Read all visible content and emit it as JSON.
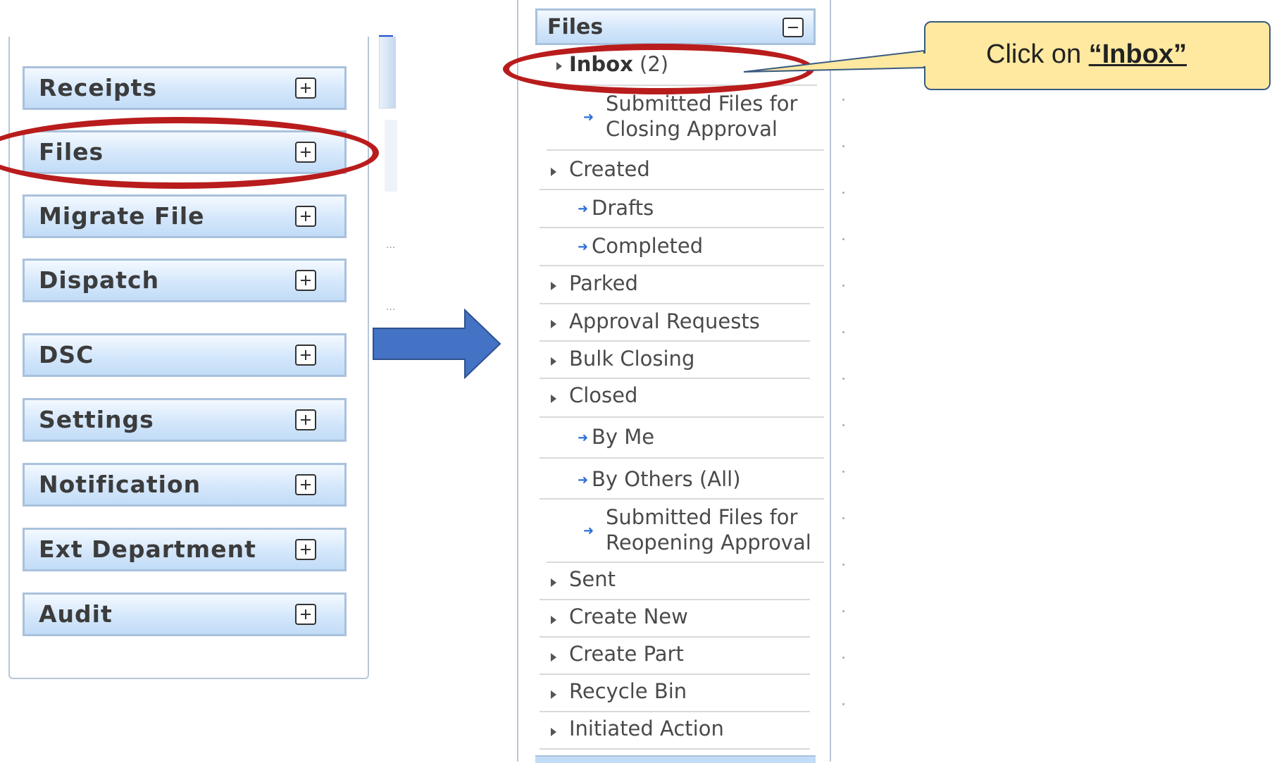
{
  "left_menu": {
    "items": [
      {
        "label": "Receipts"
      },
      {
        "label": "Files"
      },
      {
        "label": "Migrate File"
      },
      {
        "label": "Dispatch"
      },
      {
        "label": "DSC"
      },
      {
        "label": "Settings"
      },
      {
        "label": "Notification"
      },
      {
        "label": "Ext Department"
      },
      {
        "label": "Audit"
      }
    ],
    "dots": "..."
  },
  "files_panel": {
    "header": "Files",
    "items": [
      {
        "label": "Inbox",
        "count": "(2)"
      },
      {
        "line1": "Submitted Files for",
        "line2": "Closing Approval"
      },
      {
        "label": "Created"
      },
      {
        "label": "Drafts"
      },
      {
        "label": "Completed"
      },
      {
        "label": "Parked"
      },
      {
        "label": "Approval Requests"
      },
      {
        "label": "Bulk Closing"
      },
      {
        "label": "Closed"
      },
      {
        "label": "By Me"
      },
      {
        "label": "By Others (All)"
      },
      {
        "line1": "Submitted Files for",
        "line2": "Reopening Approval"
      },
      {
        "label": "Sent"
      },
      {
        "label": "Create New"
      },
      {
        "label": "Create Part"
      },
      {
        "label": "Recycle Bin"
      },
      {
        "label": "Initiated Action"
      }
    ]
  },
  "callout": {
    "prefix": "Click on ",
    "target": "“Inbox”"
  },
  "colors": {
    "highlight_ring": "#b91c1c",
    "arrow": "#4472c4",
    "callout_bg": "#ffe9a0"
  },
  "icons": {
    "expand": "plus-box-icon",
    "collapse": "minus-box-icon",
    "submenu": "blue-arrow-icon",
    "tree": "triangle-right-icon"
  }
}
